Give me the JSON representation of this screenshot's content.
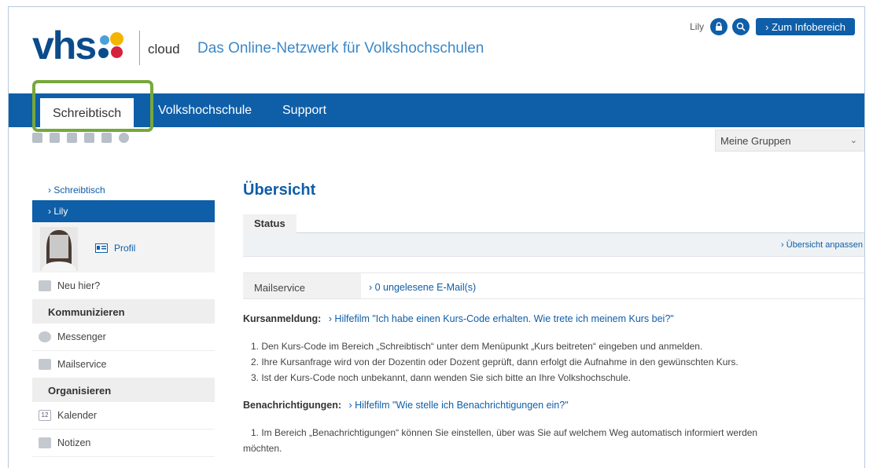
{
  "header": {
    "logo_text": "vhs",
    "logo_cloud": "cloud",
    "slogan": "Das Online-Netzwerk für Volkshochschulen",
    "user": "Lily",
    "info_button": "› Zum Infobereich",
    "icons": [
      "lock-icon",
      "search-icon"
    ]
  },
  "nav": {
    "tabs": [
      {
        "label": "Schreibtisch",
        "active": true
      },
      {
        "label": "Volkshochschule",
        "active": false
      },
      {
        "label": "Support",
        "active": false
      }
    ]
  },
  "toolbar": {
    "groups_select": "Meine Gruppen"
  },
  "sidebar": {
    "breadcrumb": "› Schreibtisch",
    "active_user": "› Lily",
    "profile_label": "Profil",
    "items": [
      {
        "label": "Neu hier?",
        "icon": "new-user-icon"
      },
      {
        "section": "Kommunizieren"
      },
      {
        "label": "Messenger",
        "icon": "messenger-icon"
      },
      {
        "label": "Mailservice",
        "icon": "mail-icon"
      },
      {
        "section": "Organisieren"
      },
      {
        "label": "Kalender",
        "icon": "calendar-icon"
      },
      {
        "label": "Notizen",
        "icon": "notes-icon"
      }
    ],
    "labels": {
      "new": "Neu hier?",
      "communicate": "Kommunizieren",
      "messenger": "Messenger",
      "mailservice": "Mailservice",
      "organize": "Organisieren",
      "calendar": "Kalender",
      "calendar_num": "12",
      "notes": "Notizen"
    }
  },
  "main": {
    "title": "Übersicht",
    "status_tab": "Status",
    "adjust_link": "› Übersicht anpassen",
    "mail_label": "Mailservice",
    "mail_value": "› 0 ungelesene E-Mail(s)",
    "kurs_label": "Kursanmeldung:",
    "kurs_link": "› Hilfefilm \"Ich habe einen Kurs-Code erhalten. Wie trete ich meinem Kurs bei?\"",
    "kurs_steps": [
      "1. Den Kurs-Code im Bereich „Schreibtisch“ unter dem Menüpunkt „Kurs beitreten“ eingeben und anmelden.",
      "2. Ihre Kursanfrage wird von der Dozentin oder Dozent geprüft, dann erfolgt die Aufnahme in den gewünschten Kurs.",
      "3. Ist der Kurs-Code noch unbekannt, dann wenden Sie sich bitte an Ihre Volkshochschule."
    ],
    "notify_label": "Benachrichtigungen:",
    "notify_link": "› Hilfefilm \"Wie stelle ich Benachrichtigungen ein?\"",
    "notify_steps": [
      "1. Im Bereich „Benachrichtigungen“ können Sie einstellen, über was Sie auf welchem Weg automatisch informiert werden",
      "möchten."
    ]
  },
  "colors": {
    "brand_blue": "#0f5ea8",
    "highlight_green": "#76a83b",
    "slogan_blue": "#3c88c7"
  }
}
